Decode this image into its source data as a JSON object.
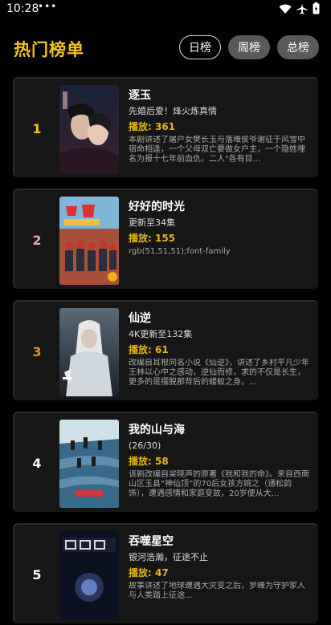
{
  "status": {
    "time": "10:28",
    "dots": "•••"
  },
  "header": {
    "title": "热门榜单",
    "tabs": [
      {
        "label": "日榜",
        "active": true
      },
      {
        "label": "周榜",
        "active": false
      },
      {
        "label": "总榜",
        "active": false
      }
    ]
  },
  "items": [
    {
      "rank": "1",
      "title": "逐玉",
      "subtitle": "先婚后爱！烽火炼真情",
      "plays": "播放: 361",
      "desc": "本剧讲述了屠户女樊长玉与落难侯爷谢征于风雪中宿命相逢，一个父母双亡要做女户主，一个隐姓埋名为报十七年前血仇，二人\"各有目..."
    },
    {
      "rank": "2",
      "title": "好好的时光",
      "subtitle": "更新至34集",
      "plays": "播放: 155",
      "desc": "rgb(51,51,51);font-family"
    },
    {
      "rank": "3",
      "title": "仙逆",
      "subtitle": "4K更新至132集",
      "plays": "播放: 61",
      "desc": "改编自耳根同名小说《仙逆》，讲述了乡村平凡少年王林以心中之感动，逆仙而修，求的不仅是长生，更多的是摆脱那背后的蝼蚁之身。..."
    },
    {
      "rank": "4",
      "title": "我的山与海",
      "subtitle": "(26/30)",
      "plays": "播放: 58",
      "desc": "该剧改编自梁晓声的原著《我和我的命》。来自西南山区玉县“神仙顶”的70后女孩方婉之（通松韵饰），遭遇感情和家庭变故，20岁便从大..."
    },
    {
      "rank": "5",
      "title": "吞噬星空",
      "subtitle": "银河浩瀚，征途不止",
      "plays": "播放: 47",
      "desc": "故事讲述了地球遭遇大灾变之后，罗峰为守护家人与人类踏上征途..."
    }
  ]
}
